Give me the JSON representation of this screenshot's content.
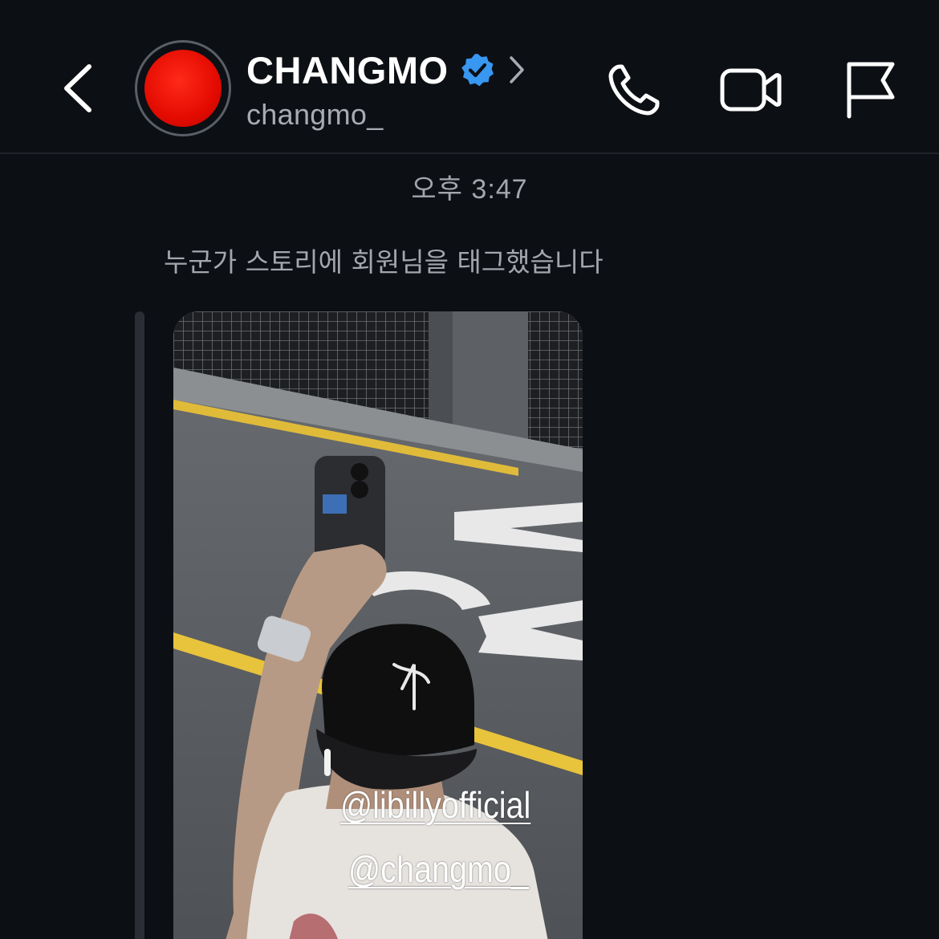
{
  "header": {
    "display_name": "CHANGMO",
    "username": "changmo_",
    "verified": true,
    "avatar_color": "#e30b00",
    "verified_color": "#3897f0"
  },
  "conversation": {
    "timestamp": "오후 3:47",
    "tag_notice": "누군가 스토리에 회원님을 태그했습니다",
    "story": {
      "mentions": [
        "@libillyofficial",
        "@changmo_"
      ]
    }
  },
  "icons": {
    "back": "chevron-left-icon",
    "profile_link": "chevron-right-icon",
    "verified": "verified-badge-icon",
    "call": "phone-icon",
    "video": "video-camera-icon",
    "report": "flag-icon"
  },
  "colors": {
    "background": "#0c0f14",
    "secondary_text": "#a3a7ad",
    "divider": "#1f2329"
  }
}
